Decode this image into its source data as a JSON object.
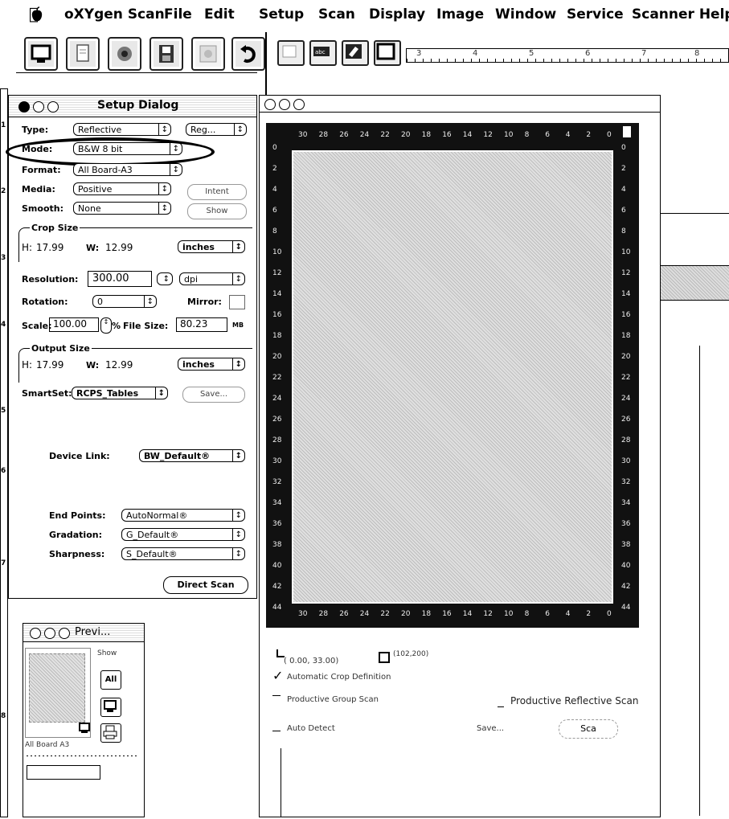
{
  "menubar": {
    "app_name": "oXYgen Scan",
    "items": [
      "File",
      "Edit",
      "Setup",
      "Scan",
      "Display",
      "Image",
      "Window",
      "Service",
      "Scanner Help"
    ]
  },
  "ruler_top": {
    "numbers": [
      "3",
      "4",
      "5",
      "6",
      "7",
      "8"
    ]
  },
  "setup_dialog": {
    "title": "Setup Dialog",
    "type_label": "Type:",
    "type_value": "Reflective",
    "type_extra": "Reg...",
    "mode_label": "Mode:",
    "mode_value": "B&W 8 bit",
    "format_label": "Format:",
    "format_value": "All Board-A3",
    "media_label": "Media:",
    "media_value": "Positive",
    "intent_button": "Intent",
    "smooth_label": "Smooth:",
    "smooth_value": "None",
    "show_button": "Show",
    "crop_size_label": "Crop Size",
    "crop_h_label": "H:",
    "crop_h_value": "17.99",
    "crop_w_label": "W:",
    "crop_w_value": "12.99",
    "crop_unit": "inches",
    "resolution_label": "Resolution:",
    "resolution_value": "300.00",
    "resolution_unit": "dpi",
    "rotation_label": "Rotation:",
    "rotation_value": "0",
    "mirror_label": "Mirror:",
    "scale_label": "Scale:",
    "scale_value": "100.00",
    "scale_unit": "%",
    "filesize_label": "File Size:",
    "filesize_value": "80.23",
    "filesize_unit": "MB",
    "output_size_label": "Output Size",
    "out_h_label": "H:",
    "out_h_value": "17.99",
    "out_w_label": "W:",
    "out_w_value": "12.99",
    "out_unit": "inches",
    "smartset_label": "SmartSet:",
    "smartset_value": "RCPS_Tables",
    "save_button": "Save...",
    "device_link_label": "Device Link:",
    "device_link_value": "BW_Default®",
    "end_points_label": "End Points:",
    "end_points_value": "AutoNormal®",
    "gradation_label": "Gradation:",
    "gradation_value": "G_Default®",
    "sharpness_label": "Sharpness:",
    "sharpness_value": "S_Default®",
    "direct_scan_button": "Direct Scan"
  },
  "preview_window": {
    "title": "Previ...",
    "show_label": "Show",
    "all_button": "All",
    "thumb_label": "All Board A3"
  },
  "scan_window": {
    "top_ticks": [
      "30",
      "28",
      "26",
      "24",
      "22",
      "20",
      "18",
      "16",
      "14",
      "12",
      "10",
      "8",
      "6",
      "4",
      "2",
      "0"
    ],
    "bottom_ticks": [
      "30",
      "28",
      "26",
      "24",
      "22",
      "20",
      "18",
      "16",
      "14",
      "12",
      "10",
      "8",
      "6",
      "4",
      "2",
      "0"
    ],
    "side_ticks": [
      "0",
      "2",
      "4",
      "6",
      "8",
      "10",
      "12",
      "14",
      "16",
      "18",
      "20",
      "22",
      "24",
      "26",
      "28",
      "30",
      "32",
      "34",
      "36",
      "38",
      "40",
      "42",
      "44"
    ],
    "coord_start": "( 0.00, 33.00)",
    "coord_end": "(102,200)",
    "auto_crop_label": "Automatic Crop Definition",
    "auto_crop_checked": true,
    "productive_group_label": "Productive Group Scan",
    "productive_reflective_label": "Productive Reflective Scan",
    "auto_detect_label": "Auto Detect",
    "save_label": "Save...",
    "scan_button": "Sca"
  },
  "side_ruler_numbers": [
    "1",
    "2",
    "3",
    "4",
    "5",
    "6",
    "7",
    "8"
  ]
}
